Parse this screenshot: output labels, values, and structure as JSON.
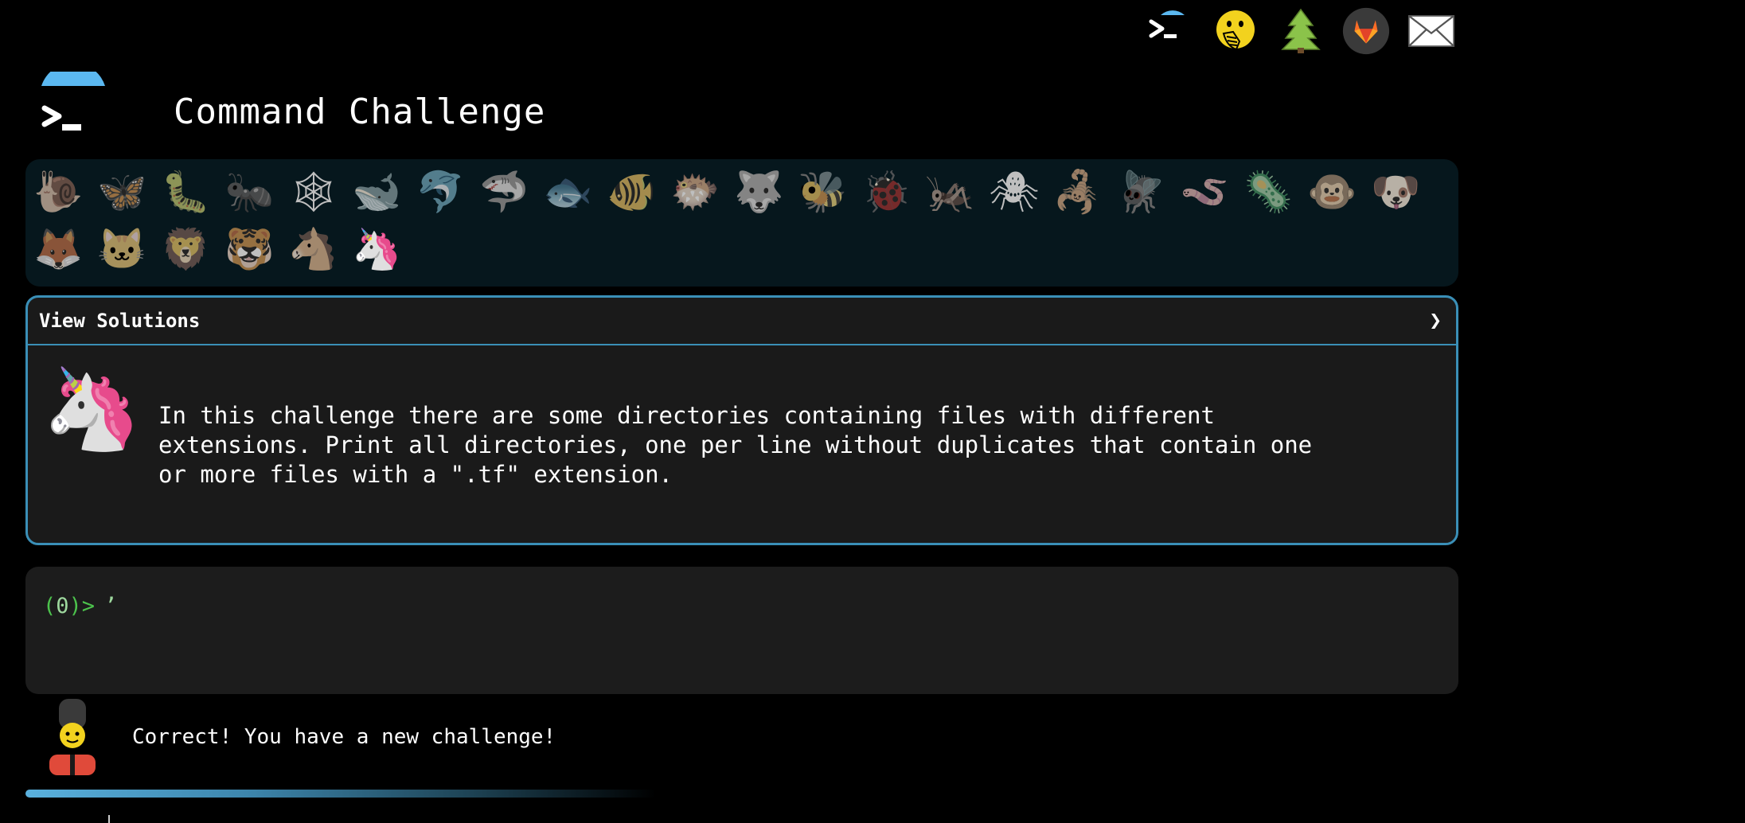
{
  "top_icons": [
    {
      "name": "terminal-logo-icon"
    },
    {
      "name": "face-with-hand-over-mouth-icon",
      "glyph": "🤭"
    },
    {
      "name": "evergreen-tree-icon",
      "glyph": "🌲"
    },
    {
      "name": "gitlab-icon"
    },
    {
      "name": "envelope-icon"
    }
  ],
  "header": {
    "title": "Command Challenge"
  },
  "animals": [
    {
      "name": "snail",
      "glyph": "🐌"
    },
    {
      "name": "butterfly",
      "glyph": "🦋"
    },
    {
      "name": "caterpillar",
      "glyph": "🐛"
    },
    {
      "name": "ant",
      "glyph": "🐜"
    },
    {
      "name": "spider-web",
      "glyph": "🕸"
    },
    {
      "name": "whale",
      "glyph": "🐋"
    },
    {
      "name": "dolphin",
      "glyph": "🐬"
    },
    {
      "name": "shark",
      "glyph": "🦈"
    },
    {
      "name": "fish",
      "glyph": "🐟"
    },
    {
      "name": "tropical-fish",
      "glyph": "🐠"
    },
    {
      "name": "blowfish",
      "glyph": "🐡"
    },
    {
      "name": "wolf",
      "glyph": "🐺"
    },
    {
      "name": "bee",
      "glyph": "🐝"
    },
    {
      "name": "ladybug",
      "glyph": "🐞"
    },
    {
      "name": "cricket",
      "glyph": "🦗"
    },
    {
      "name": "spider",
      "glyph": "🕷"
    },
    {
      "name": "scorpion",
      "glyph": "🦂"
    },
    {
      "name": "fly",
      "glyph": "🪰"
    },
    {
      "name": "worm",
      "glyph": "🪱"
    },
    {
      "name": "microbe",
      "glyph": "🦠"
    },
    {
      "name": "monkey",
      "glyph": "🐵"
    },
    {
      "name": "dog",
      "glyph": "🐶"
    },
    {
      "name": "fox",
      "glyph": "🦊"
    },
    {
      "name": "cat",
      "glyph": "🐱"
    },
    {
      "name": "lion",
      "glyph": "🦁"
    },
    {
      "name": "tiger",
      "glyph": "🐯"
    },
    {
      "name": "horse",
      "glyph": "🐴"
    },
    {
      "name": "unicorn",
      "glyph": "🦄",
      "active": true
    }
  ],
  "challenge": {
    "solutions_label": "View Solutions",
    "chevron": "❯",
    "animal_glyph": "🦄",
    "text": "In this challenge there are some directories containing files with different\nextensions. Print all directories, one per line without duplicates that contain one\nor more files with a \".tf\" extension."
  },
  "terminal": {
    "prompt_open": "(",
    "prompt_count": "0",
    "prompt_close": ")>",
    "input_value": "’"
  },
  "feedback": {
    "text": "Correct! You have a new challenge!"
  },
  "progress": {
    "fraction": 0.44
  },
  "colors": {
    "accent": "#3a8fb7",
    "prompt_green": "#4cc24c",
    "panel_bg": "#1a1a1a",
    "animal_bar_bg": "#06171d"
  }
}
